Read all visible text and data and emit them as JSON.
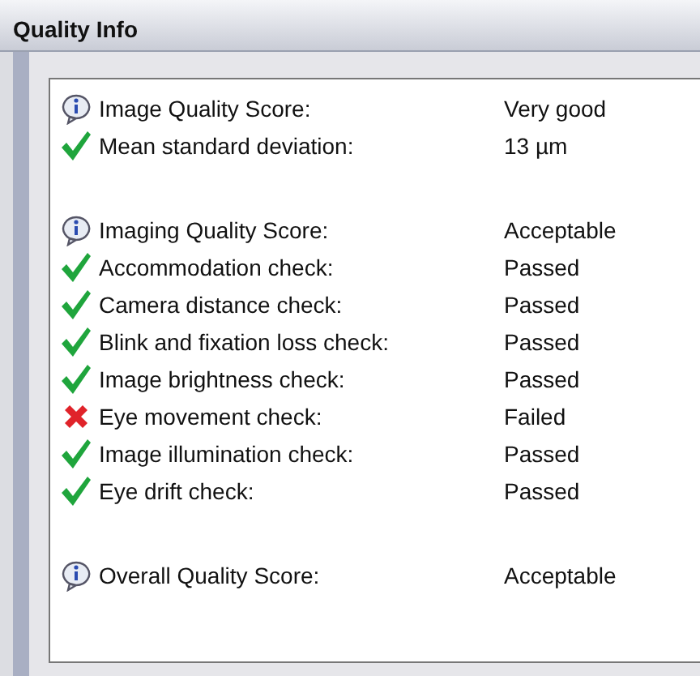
{
  "window": {
    "title": "Quality Info"
  },
  "groups": [
    {
      "rows": [
        {
          "kind": "info",
          "label": "Image Quality Score:",
          "value": "Very good"
        },
        {
          "kind": "pass",
          "label": "Mean standard deviation:",
          "value": "13 µm"
        }
      ]
    },
    {
      "rows": [
        {
          "kind": "info",
          "label": "Imaging Quality Score:",
          "value": "Acceptable"
        },
        {
          "kind": "pass",
          "label": "Accommodation check:",
          "value": "Passed"
        },
        {
          "kind": "pass",
          "label": "Camera distance check:",
          "value": "Passed"
        },
        {
          "kind": "pass",
          "label": "Blink and fixation loss check:",
          "value": "Passed"
        },
        {
          "kind": "pass",
          "label": "Image brightness check:",
          "value": "Passed"
        },
        {
          "kind": "fail",
          "label": "Eye movement check:",
          "value": "Failed"
        },
        {
          "kind": "pass",
          "label": "Image illumination check:",
          "value": "Passed"
        },
        {
          "kind": "pass",
          "label": "Eye drift check:",
          "value": "Passed"
        }
      ]
    },
    {
      "rows": [
        {
          "kind": "info",
          "label": "Overall Quality Score:",
          "value": "Acceptable"
        }
      ]
    }
  ]
}
